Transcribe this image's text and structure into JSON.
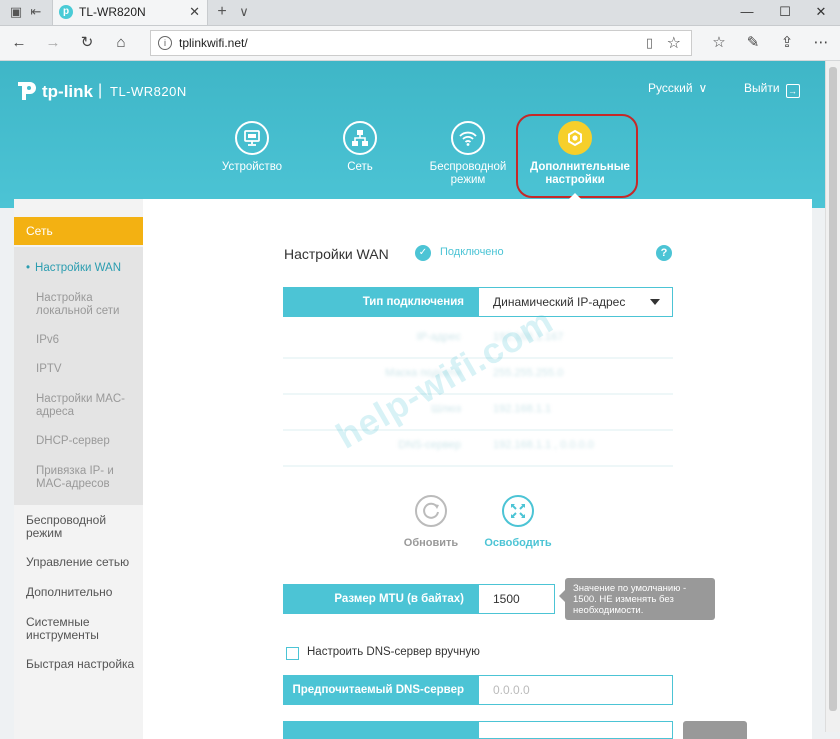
{
  "browser": {
    "tab_title": "TL-WR820N",
    "favicon_glyph": "p",
    "url": "tplinkwifi.net/",
    "new_tab_glyph": "+",
    "tab_menu_glyph": "∨",
    "close_glyph": "✕",
    "window_buttons": {
      "minimize": "—",
      "maximize": "☐",
      "close": "✕"
    }
  },
  "header": {
    "brand": "tp-link",
    "separator": "|",
    "model": "TL-WR820N",
    "language": "Русский",
    "logout": "Выйти",
    "nav": [
      {
        "label": "Устройство",
        "icon": "monitor-icon"
      },
      {
        "label": "Сеть",
        "icon": "network-icon"
      },
      {
        "label": "Беспроводной режим",
        "icon": "wifi-icon"
      },
      {
        "label": "Дополнительные настройки",
        "icon": "gear-icon"
      }
    ]
  },
  "sidebar": {
    "active_section": "Сеть",
    "sub_items": [
      {
        "label": "Настройки WAN",
        "active": true
      },
      {
        "label": "Настройка локальной сети"
      },
      {
        "label": "IPv6"
      },
      {
        "label": "IPTV"
      },
      {
        "label": "Настройки MAC-адреса"
      },
      {
        "label": "DHCP-сервер"
      },
      {
        "label": "Привязка IP- и MAC-адресов"
      }
    ],
    "sections": [
      {
        "label": "Беспроводной режим"
      },
      {
        "label": "Управление сетью"
      },
      {
        "label": "Дополнительно"
      },
      {
        "label": "Системные инструменты"
      },
      {
        "label": "Быстрая настройка"
      }
    ]
  },
  "wan": {
    "title": "Настройки WAN",
    "status": "Подключено",
    "help": "?",
    "connection_type_label": "Тип подключения",
    "connection_type_value": "Динамический IP-адрес",
    "blurred_rows": [
      {
        "label": "IP-адрес",
        "value": "192.168.1.167"
      },
      {
        "label": "Маска подсети",
        "value": "255.255.255.0"
      },
      {
        "label": "Шлюз",
        "value": "192.168.1.1"
      },
      {
        "label": "DNS-сервер",
        "value": "192.168.1.1 , 0.0.0.0"
      }
    ],
    "refresh_label": "Обновить",
    "release_label": "Освободить",
    "mtu_label": "Размер MTU (в байтах)",
    "mtu_value": "1500",
    "mtu_tip": "Значение по умолчанию - 1500. НЕ изменять без необходимости.",
    "dns_manual_label": "Настроить DNS-сервер вручную",
    "dns_manual_checked": false,
    "preferred_dns_label": "Предпочитаемый DNS-сервер",
    "preferred_dns_placeholder": "0.0.0.0"
  },
  "watermark": "help-wifi.com",
  "colors": {
    "accent": "#4cc4d5",
    "active_orange": "#f3b112",
    "advanced_yellow": "#f6cf2b",
    "highlight_red": "#c62828"
  }
}
